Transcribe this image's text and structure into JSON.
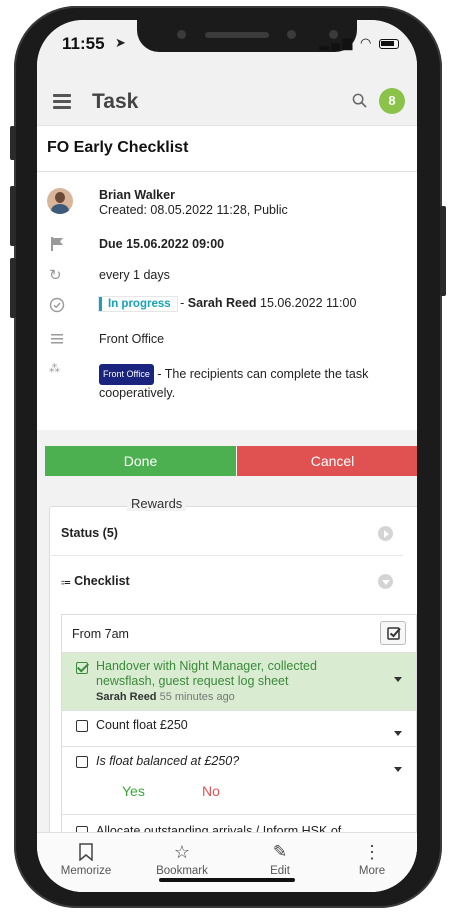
{
  "status": {
    "time": "11:55"
  },
  "appbar": {
    "title": "Task",
    "notification_count": "8"
  },
  "task": {
    "title": "FO Early Checklist",
    "author": "Brian Walker",
    "created": "Created: 08.05.2022 11:28, Public",
    "due": "Due 15.06.2022 09:00",
    "repeat": "every 1 days",
    "status_tag": "In progress",
    "status_sep": " - ",
    "status_user": "Sarah Reed",
    "status_time": " 15.06.2022 11:00",
    "location": "Front Office",
    "recipient_tag": "Front Office",
    "recipient_text_line1": " - The recipients can complete the task",
    "recipient_text_line2": "cooperatively."
  },
  "actions": {
    "done": "Done",
    "cancel": "Cancel"
  },
  "rewards": {
    "legend": "Rewards"
  },
  "sections": {
    "status": "Status (5)",
    "checklist": "Checklist"
  },
  "checklist": {
    "group": "From 7am",
    "items": [
      {
        "line1": "Handover with Night Manager, collected",
        "line2": "newsflash, guest request log sheet",
        "by": "Sarah Reed",
        "ago": " 55 minutes ago"
      },
      {
        "line1": "Count float £250"
      },
      {
        "line1": "Is float balanced at £250?",
        "yes": "Yes",
        "no": "No"
      },
      {
        "line1": "Allocate outstanding arrivals / Inform HSK of"
      }
    ]
  },
  "tabbar": {
    "memorize": "Memorize",
    "bookmark": "Bookmark",
    "edit": "Edit",
    "more": "More"
  },
  "colors": {
    "done": "#4caf50",
    "cancel": "#e05252",
    "badge": "#8bc34a",
    "in_progress": "#17a2b8"
  }
}
